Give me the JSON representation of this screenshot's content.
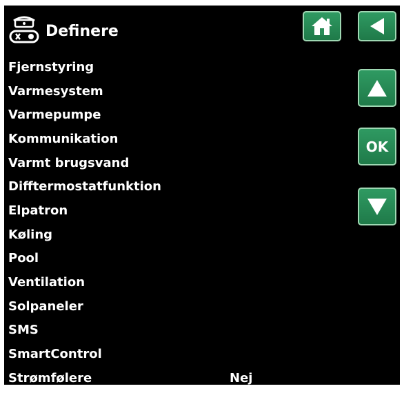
{
  "header": {
    "title": "Definere",
    "icon": "remote-control-icon"
  },
  "nav": {
    "home": "home-icon",
    "back": "back-arrow-icon",
    "up": "arrow-up-icon",
    "ok_label": "OK",
    "down": "arrow-down-icon"
  },
  "menu": {
    "items": [
      {
        "label": "Fjernstyring",
        "value": ""
      },
      {
        "label": "Varmesystem",
        "value": ""
      },
      {
        "label": "Varmepumpe",
        "value": ""
      },
      {
        "label": "Kommunikation",
        "value": ""
      },
      {
        "label": "Varmt brugsvand",
        "value": ""
      },
      {
        "label": "Difftermostatfunktion",
        "value": ""
      },
      {
        "label": "Elpatron",
        "value": ""
      },
      {
        "label": "Køling",
        "value": ""
      },
      {
        "label": "Pool",
        "value": ""
      },
      {
        "label": "Ventilation",
        "value": ""
      },
      {
        "label": "Solpaneler",
        "value": ""
      },
      {
        "label": "SMS",
        "value": ""
      },
      {
        "label": "SmartControl",
        "value": ""
      },
      {
        "label": "Strømfølere",
        "value": "Nej"
      }
    ]
  },
  "colors": {
    "background": "#000000",
    "button": "#2a8c58",
    "button_border": "#9fd8b3",
    "text": "#ffffff"
  }
}
